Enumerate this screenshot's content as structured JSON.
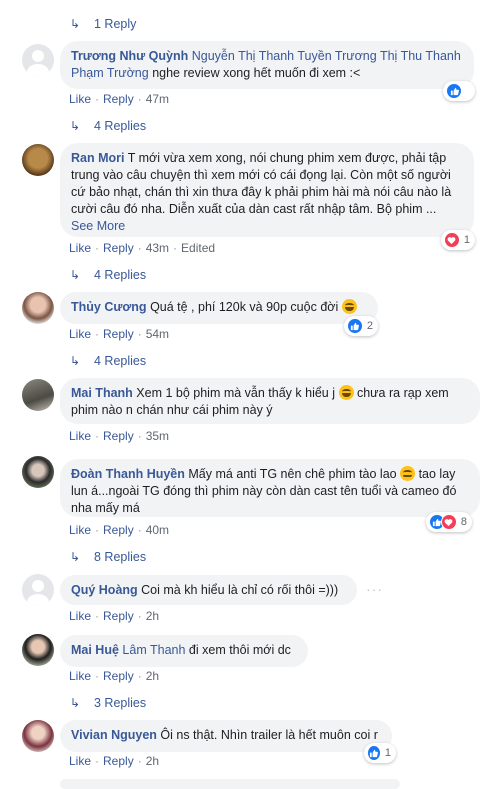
{
  "threads": [
    {
      "replies_label": "1 Reply"
    },
    {
      "author": "Trương Như Quỳnh",
      "text_before": "",
      "tags": "Nguyễn Thị Thanh Tuyền Trương Thị Thu Thanh Phạm Trường",
      "text": "nghe review xong hết muốn đi xem :<",
      "like": "Like",
      "reply": "Reply",
      "time": "47m",
      "reactions": "",
      "replies_label": "4 Replies"
    },
    {
      "author": "Ran Mori",
      "text": "T mới vừa xem xong, nói chung phim xem được, phải tập trung vào câu chuyện thì xem mới có cái đọng lại. Còn một số người cứ bảo nhạt, chán thì xin thưa đây k phải phim hài mà nói câu nào là cười câu đó nha. Diễn xuất của dàn cast rất nhập tâm. Bộ phim ...",
      "see_more": "See More",
      "like": "Like",
      "reply": "Reply",
      "time": "43m",
      "edited": "Edited",
      "reactions": "1",
      "replies_label": "4 Replies"
    },
    {
      "author": "Thủy Cương",
      "text": "Quá tệ , phí 120k và 90p cuộc đời",
      "like": "Like",
      "reply": "Reply",
      "time": "54m",
      "reactions": "2",
      "replies_label": "4 Replies"
    },
    {
      "author": "Mai Thanh",
      "text_a": "Xem 1 bộ phim mà vẫn thấy k hiểu j",
      "text_b": "chưa ra rạp xem phim nào n chán như cái phim này ý",
      "like": "Like",
      "reply": "Reply",
      "time": "35m"
    },
    {
      "author": "Đoàn Thanh Huyền",
      "text_a": "Mấy má anti TG nên chê phim tào lao",
      "text_b": "tao lay lun á...ngoài TG đóng thì phim này còn dàn cast tên tuổi và cameo đó nha mấy má",
      "like": "Like",
      "reply": "Reply",
      "time": "40m",
      "reactions": "8",
      "replies_label": "8 Replies"
    },
    {
      "author": "Quý Hoàng",
      "text": "Coi mà kh hiểu là chỉ có rối thôi =)))",
      "like": "Like",
      "reply": "Reply",
      "time": "2h"
    },
    {
      "author": "Mai Huệ",
      "tags": "Lâm Thanh",
      "text": "đi xem thôi mới dc",
      "like": "Like",
      "reply": "Reply",
      "time": "2h",
      "replies_label": "3 Replies"
    },
    {
      "author": "Vivian Nguyen",
      "text": "Ôi ns thật. Nhìn trailer là hết muôn coi r",
      "like": "Like",
      "reply": "Reply",
      "time": "2h",
      "reactions": "1"
    }
  ],
  "colors": {
    "link": "#385898",
    "bubble": "#f2f3f5",
    "like": "#1877f2",
    "love": "#f33e58"
  }
}
